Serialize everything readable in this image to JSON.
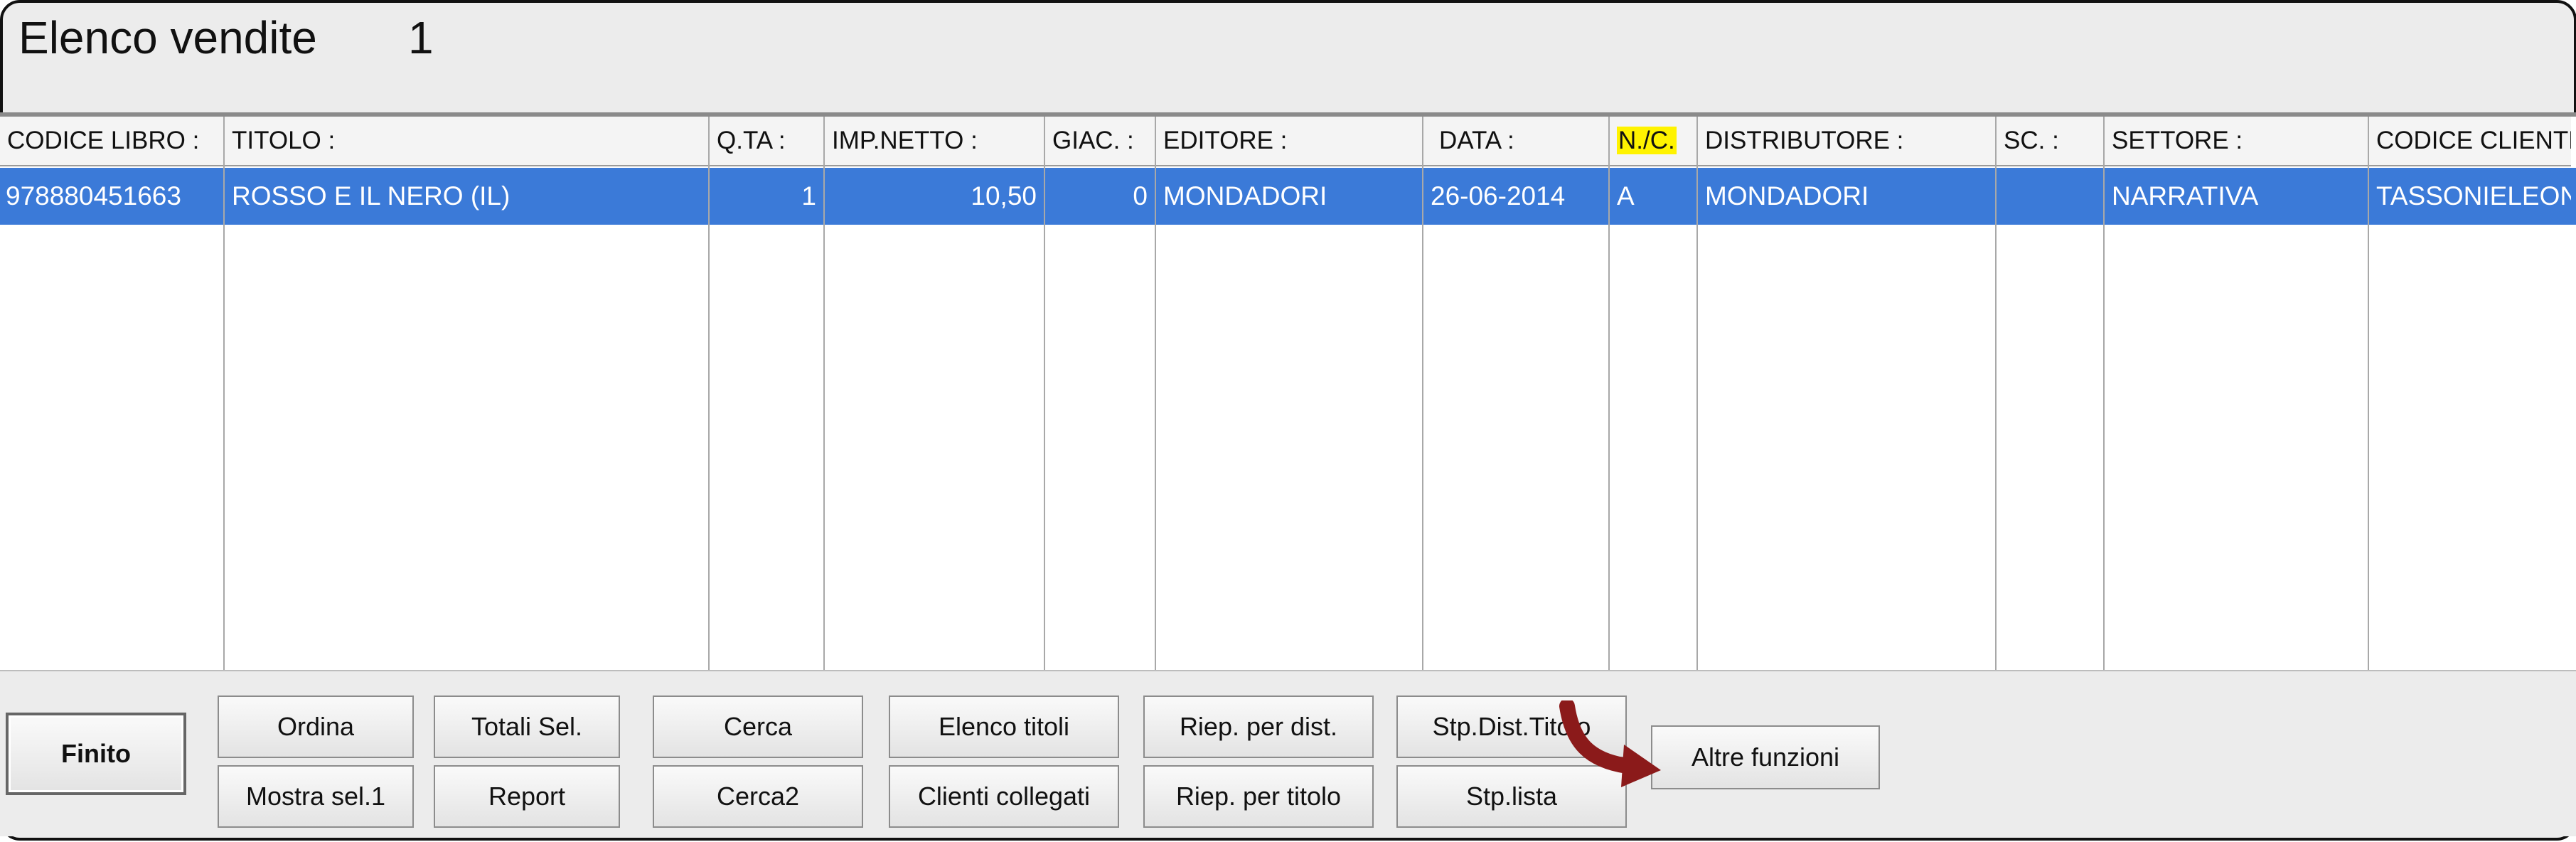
{
  "window": {
    "title": "Elenco vendite",
    "count": "1"
  },
  "table": {
    "columns": [
      "CODICE LIBRO :",
      "TITOLO :",
      "Q.TA :",
      "IMP.NETTO :",
      "GIAC. :",
      "EDITORE :",
      "DATA :",
      "N./C.",
      "DISTRIBUTORE :",
      "SC. :",
      "SETTORE :",
      "CODICE CLIENTE"
    ],
    "rows": [
      [
        "978880451663",
        "ROSSO E IL NERO (IL)",
        "1",
        "10,50",
        "0",
        "MONDADORI",
        "26-06-2014",
        "A",
        "MONDADORI",
        "",
        "NARRATIVA",
        "TASSONIELEON"
      ]
    ]
  },
  "buttons": {
    "finito": "Finito",
    "ordina": "Ordina",
    "mostra_sel": "Mostra sel.1",
    "totali_sel": "Totali Sel.",
    "report": "Report",
    "cerca": "Cerca",
    "cerca2": "Cerca2",
    "elenco_titoli": "Elenco titoli",
    "clienti_collegati": "Clienti collegati",
    "riep_dist": "Riep. per dist.",
    "riep_titolo": "Riep. per titolo",
    "stp_dist_titolo": "Stp.Dist.Titolo",
    "stp_lista": "Stp.lista",
    "altre_funzioni": "Altre funzioni"
  },
  "colors": {
    "selection": "#3b7ad8",
    "highlight": "#fff300",
    "arrow": "#8b1a1a"
  },
  "icons": {
    "arrow": "curved-arrow-icon"
  }
}
